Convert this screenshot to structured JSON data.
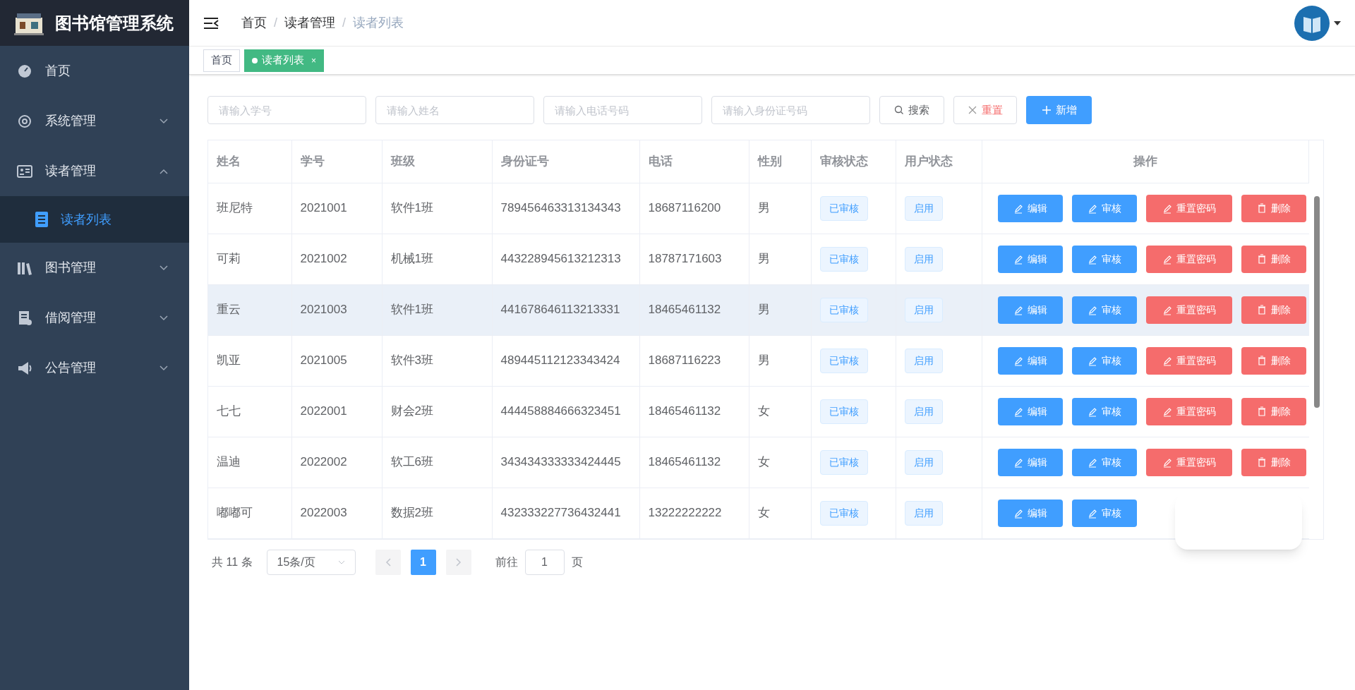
{
  "app": {
    "title": "图书馆管理系统"
  },
  "sidebar": {
    "items": [
      {
        "label": "首页",
        "kind": "link",
        "selected": false
      },
      {
        "label": "系统管理",
        "kind": "submenu",
        "expanded": false,
        "selected": false
      },
      {
        "label": "读者管理",
        "kind": "submenu",
        "expanded": true,
        "selected": false,
        "children": [
          {
            "label": "读者列表",
            "selected": true
          }
        ]
      },
      {
        "label": "图书管理",
        "kind": "submenu",
        "expanded": false,
        "selected": false
      },
      {
        "label": "借阅管理",
        "kind": "submenu",
        "expanded": false,
        "selected": false
      },
      {
        "label": "公告管理",
        "kind": "submenu",
        "expanded": false,
        "selected": false
      }
    ]
  },
  "breadcrumb": {
    "separator": "/",
    "items": [
      "首页",
      "读者管理",
      "读者列表"
    ]
  },
  "tabs": [
    {
      "label": "首页",
      "selected": false
    },
    {
      "label": "读者列表",
      "selected": true,
      "close": "×"
    }
  ],
  "search": {
    "fields": [
      {
        "placeholder": "请输入学号"
      },
      {
        "placeholder": "请输入姓名"
      },
      {
        "placeholder": "请输入电话号码"
      },
      {
        "placeholder": "请输入身份证号码"
      }
    ],
    "buttons": [
      {
        "label": "搜索",
        "kind": "plain"
      },
      {
        "label": "重置",
        "kind": "danger-plain"
      },
      {
        "label": "新增",
        "kind": "primary"
      }
    ]
  },
  "table": {
    "columns": [
      "姓名",
      "学号",
      "班级",
      "身份证号",
      "电话",
      "性别",
      "审核状态",
      "用户状态",
      "操作"
    ],
    "rows": [
      {
        "cells": [
          "班尼特",
          "2021001",
          "软件1班",
          "789456463313134343",
          "18687116200",
          "男"
        ],
        "audit": "已审核",
        "status": "启用",
        "hovered": false,
        "actions": [
          "编辑",
          "审核",
          "重置密码",
          "删除"
        ]
      },
      {
        "cells": [
          "可莉",
          "2021002",
          "机械1班",
          "443228945613212313",
          "18787171603",
          "男"
        ],
        "audit": "已审核",
        "status": "启用",
        "hovered": false,
        "actions": [
          "编辑",
          "审核",
          "重置密码",
          "删除"
        ]
      },
      {
        "cells": [
          "重云",
          "2021003",
          "软件1班",
          "441678646113213331",
          "18465461132",
          "男"
        ],
        "audit": "已审核",
        "status": "启用",
        "hovered": true,
        "actions": [
          "编辑",
          "审核",
          "重置密码",
          "删除"
        ]
      },
      {
        "cells": [
          "凯亚",
          "2021005",
          "软件3班",
          "489445112123343424",
          "18687116223",
          "男"
        ],
        "audit": "已审核",
        "status": "启用",
        "hovered": false,
        "actions": [
          "编辑",
          "审核",
          "重置密码",
          "删除"
        ]
      },
      {
        "cells": [
          "七七",
          "2022001",
          "财会2班",
          "444458884666323451",
          "18465461132",
          "女"
        ],
        "audit": "已审核",
        "status": "启用",
        "hovered": false,
        "actions": [
          "编辑",
          "审核",
          "重置密码",
          "删除"
        ]
      },
      {
        "cells": [
          "温迪",
          "2022002",
          "软工6班",
          "343434333333424445",
          "18465461132",
          "女"
        ],
        "audit": "已审核",
        "status": "启用",
        "hovered": false,
        "actions": [
          "编辑",
          "审核",
          "重置密码",
          "删除"
        ]
      },
      {
        "cells": [
          "嘟嘟可",
          "2022003",
          "数据2班",
          "432333227736432441",
          "13222222222",
          "女"
        ],
        "audit": "已审核",
        "status": "启用",
        "hovered": false,
        "actions": [
          "编辑",
          "审核"
        ]
      }
    ]
  },
  "pagination": {
    "total": "共 11 条",
    "page_size": "15条/页",
    "pages": [
      {
        "label": "1",
        "selected": true
      }
    ],
    "goto_label": "前往",
    "goto_value": "1",
    "goto_suffix": "页"
  }
}
